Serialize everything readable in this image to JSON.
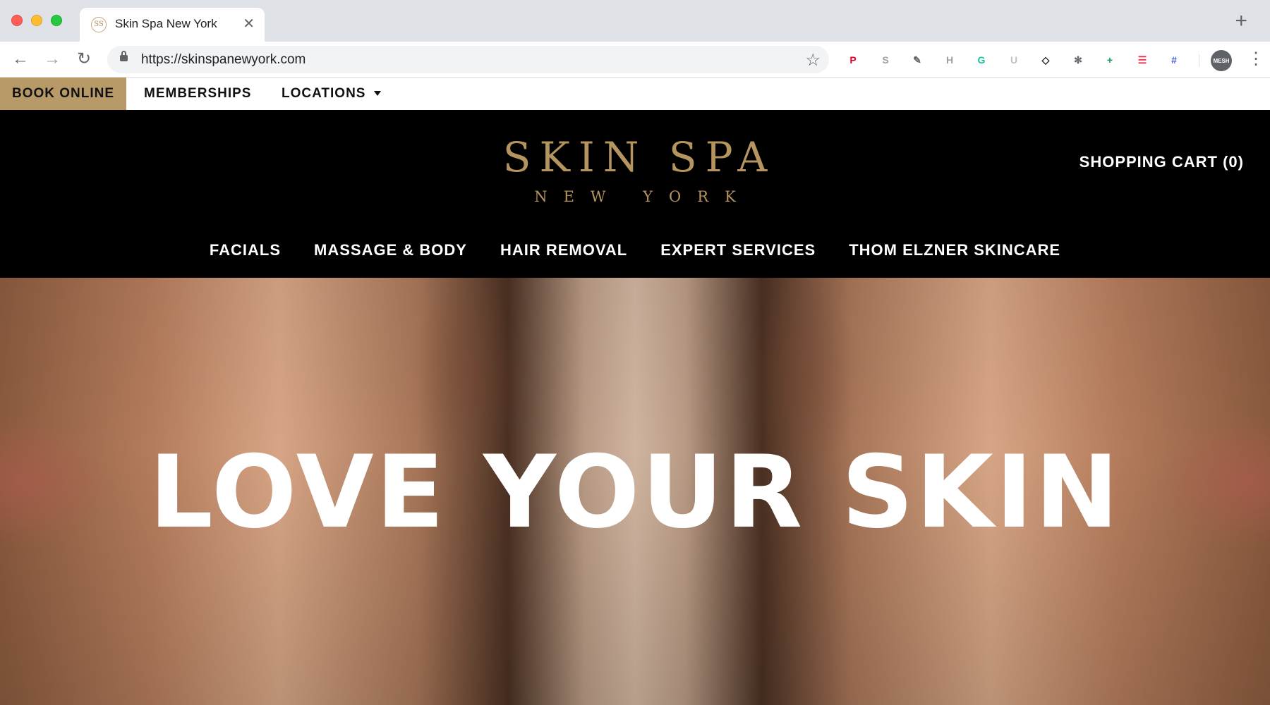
{
  "browser": {
    "tab_title": "Skin Spa New York",
    "tab_favicon": "SS",
    "tab_close": "✕",
    "new_tab": "+",
    "url": "https://skinspanewyork.com",
    "nav_back": "←",
    "nav_forward": "→",
    "nav_reload": "↻",
    "bookmark": "☆",
    "menu": "⋮",
    "extensions": [
      {
        "icon": "pinterest-icon",
        "glyph": "P",
        "color": "#e60023"
      },
      {
        "icon": "skype-icon",
        "glyph": "S",
        "color": "#9aa0a6"
      },
      {
        "icon": "eyedropper-icon",
        "glyph": "✎",
        "color": "#5f6368"
      },
      {
        "icon": "h-extension-icon",
        "glyph": "H",
        "color": "#9aa0a6"
      },
      {
        "icon": "grammarly-icon",
        "glyph": "G",
        "color": "#15c39a"
      },
      {
        "icon": "u-extension-icon",
        "glyph": "U",
        "color": "#bdc1c6"
      },
      {
        "icon": "diamond-icon",
        "glyph": "◇",
        "color": "#202124"
      },
      {
        "icon": "snowflake-icon",
        "glyph": "✻",
        "color": "#5f6368"
      },
      {
        "icon": "plus-box-icon",
        "glyph": "+",
        "color": "#0f9d58"
      },
      {
        "icon": "list-icon",
        "glyph": "☰",
        "color": "#e8334a"
      },
      {
        "icon": "frame-icon",
        "glyph": "#",
        "color": "#3b5bdb"
      }
    ],
    "profile_label": "MESH"
  },
  "utility_bar": {
    "book_online": "BOOK ONLINE",
    "memberships": "MEMBERSHIPS",
    "locations": "LOCATIONS"
  },
  "header": {
    "logo_main": "SKIN SPA",
    "logo_sub": "NEW YORK",
    "cart": "SHOPPING CART (0)",
    "nav": [
      "FACIALS",
      "MASSAGE & BODY",
      "HAIR REMOVAL",
      "EXPERT SERVICES",
      "THOM ELZNER SKINCARE"
    ]
  },
  "hero": {
    "title": "LOVE YOUR SKIN"
  },
  "colors": {
    "gold": "#b5945f",
    "book_bg": "#b89a68",
    "header_bg": "#000000"
  }
}
